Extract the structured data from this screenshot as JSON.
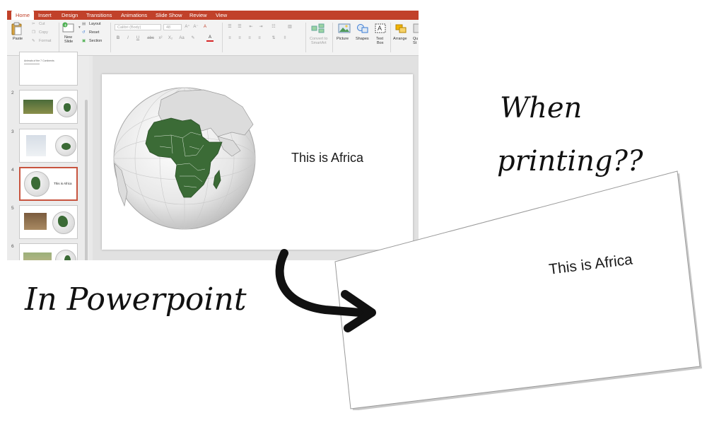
{
  "ppt": {
    "tabs": [
      "Home",
      "Insert",
      "Design",
      "Transitions",
      "Animations",
      "Slide Show",
      "Review",
      "View"
    ],
    "active_tab": "Home",
    "ribbon": {
      "paste": "Paste",
      "cut": "Cut",
      "copy": "Copy",
      "format": "Format",
      "new_slide": [
        "New",
        "Slide"
      ],
      "layout": "Layout",
      "reset": "Reset",
      "section": "Section",
      "font_name": "Calibri (Body)",
      "font_size": "48",
      "font_btns": [
        "B",
        "I",
        "U",
        "abc",
        "x²",
        "X₂",
        "Aa",
        "A"
      ],
      "convert_smartart": [
        "Convert to",
        "SmartArt"
      ],
      "picture": "Picture",
      "shapes": "Shapes",
      "text_box": [
        "Text",
        "Box"
      ],
      "arrange": "Arrange",
      "quick_styles": [
        "Qu",
        "St"
      ]
    },
    "thumbnails": [
      {
        "num": "",
        "caption": "Animals of the 7 Continents"
      },
      {
        "num": "2",
        "caption": ""
      },
      {
        "num": "3",
        "caption": ""
      },
      {
        "num": "4",
        "caption": "This is Africa",
        "selected": true
      },
      {
        "num": "5",
        "caption": ""
      },
      {
        "num": "6",
        "caption": ""
      }
    ],
    "slide_text": "This is Africa"
  },
  "print_text": "This is Africa",
  "captions": {
    "when": "When",
    "printing": "printing??",
    "in_powerpoint": "In Powerpoint"
  },
  "colors": {
    "accent": "#c1412a",
    "africa": "#3b6b36",
    "selection": "#c8543f"
  }
}
